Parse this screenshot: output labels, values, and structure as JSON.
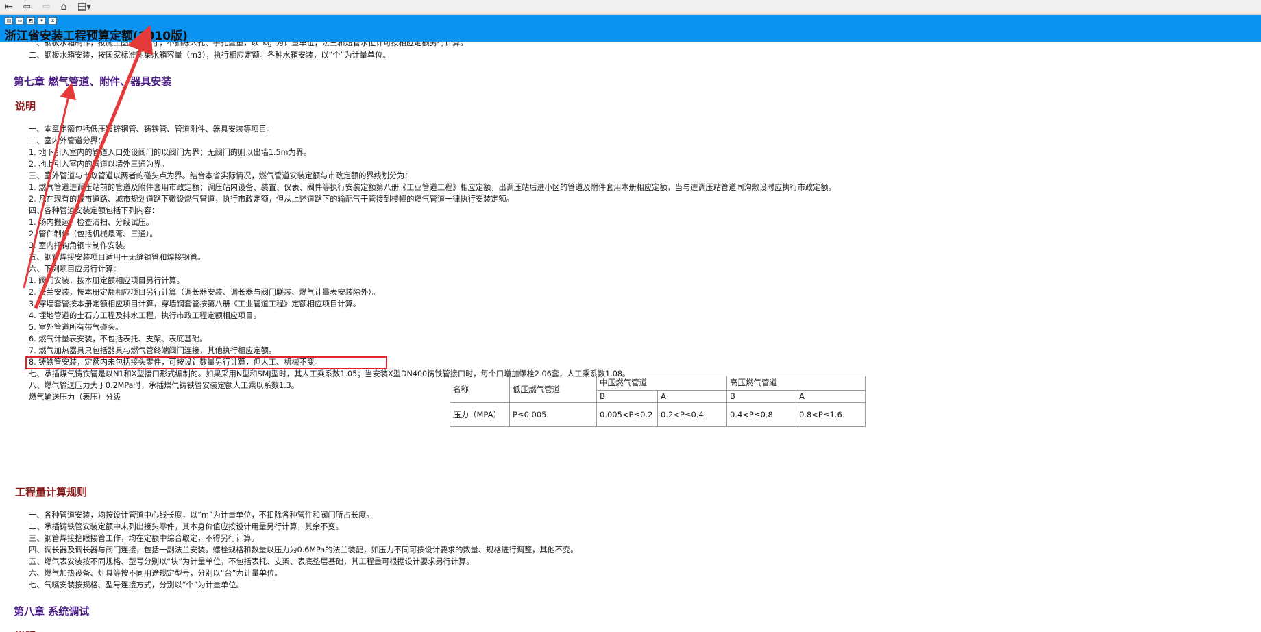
{
  "toolbar": {
    "buttons": [
      {
        "name": "toc-toggle-button",
        "glyph": "⇤"
      },
      {
        "name": "back-button",
        "glyph": "⇦"
      },
      {
        "name": "forward-button",
        "glyph": "⇨"
      },
      {
        "name": "home-button",
        "glyph": "⌂"
      },
      {
        "name": "options-button",
        "glyph": "▤▾"
      }
    ]
  },
  "strip": {
    "mini_buttons": [
      "▤",
      "▭",
      "◩",
      "▾",
      "⊻"
    ]
  },
  "document": {
    "title": "浙江省安装工程预算定额(2010版)",
    "top_lines": [
      "一、钢板水箱制作，按施工图所示尺寸，不扣除人孔、手孔重量，以“kg”为计量单位，法兰和短管水位计可按相应定额另行计算。",
      "二、钢板水箱安装，按国家标准图集水箱容量（m3），执行相应定额。各种水箱安装，以“个”为计量单位。"
    ],
    "chapter7_title": "第七章  燃气管道、附件、器具安装",
    "explain_title": "说明",
    "explain_lines": [
      "一、本章定额包括低压镀锌钢管、铸铁管、管道附件、器具安装等项目。",
      "二、室内外管道分界：",
      "1. 地下引入室内的管道入口处设阀门的以阀门为界；无阀门的则以出墙1.5m为界。",
      "2. 地上引入室内的管道以墙外三通为界。",
      "三、室外管道与市政管道以两者的碰头点为界。结合本省实际情况，燃气管道安装定额与市政定额的界线划分为：",
      "1. 燃气管道进调压站前的管道及附件套用市政定额；调压站内设备、装置、仪表、阀件等执行安装定额第八册《工业管道工程》相应定额，出调压站后进小区的管道及附件套用本册相应定额，当与进调压站管道同沟敷设时应执行市政定额。",
      "2. 凡在现有的城市道路、城市规划道路下敷设燃气管道，执行市政定额，但从上述道路下的输配气干管接到楼幢的燃气管道一律执行安装定额。",
      "四、各种管道安装定额包括下列内容：",
      "1. 场内搬运、检查清扫、分段试压。",
      "2. 管件制作（包括机械煨弯、三通）。",
      "3. 室内托钩角钢卡制作安装。",
      "五、钢管焊接安装项目适用于无缝钢管和焊接钢管。",
      "六、下列项目应另行计算：",
      "1. 阀门安装，按本册定额相应项目另行计算。",
      "2. 法兰安装，按本册定额相应项目另行计算（调长器安装、调长器与阀门联装、燃气计量表安装除外）。",
      "3. 穿墙套管按本册定额相应项目计算，穿墙钢套管按第八册《工业管道工程》定额相应项目计算。",
      "4. 埋地管道的土石方工程及排水工程，执行市政工程定额相应项目。",
      "5. 室外管道所有带气碰头。",
      "6. 燃气计量表安装，不包括表托、支架、表底基础。",
      "7. 燃气加热器具只包括器具与燃气管终端阀门连接，其他执行相应定额。",
      "8. 铸铁管安装，定额内未包括接头零件，可按设计数量另行计算，但人工、机械不变。",
      "七、承插煤气铸铁管是以N1和X型接口形式编制的。如果采用N型和SMJ型时，其人工乘系数1.05；当安装X型DN400铸铁管接口时，每个口增加螺栓2.06套，人工乘系数1.08。",
      "八、燃气输送压力大于0.2MPa时，承插煤气铸铁管安装定额人工乘以系数1.3。",
      "燃气输送压力（表压）分级"
    ],
    "pressure_table": {
      "col_name": "名称",
      "col_low": "低压燃气管道",
      "col_mid": "中压燃气管道",
      "col_high": "高压燃气管道",
      "sub_b1": "B",
      "sub_a1": "A",
      "sub_b2": "B",
      "sub_a2": "A",
      "row_label": "压力（MPA）",
      "v_low": "P≤0.005",
      "v_mid_b": "0.005<P≤0.2",
      "v_mid_a": "0.2<P≤0.4",
      "v_high_b": "0.4<P≤0.8",
      "v_high_a": "0.8<P≤1.6"
    },
    "calc_title": "工程量计算规则",
    "calc_lines": [
      "一、各种管道安装，均按设计管道中心线长度，以“m”为计量单位，不扣除各种管件和阀门所占长度。",
      "二、承插铸铁管安装定额中未列出接头零件，其本身价值应按设计用量另行计算，其余不变。",
      "三、钢管焊接挖眼接管工作，均在定额中综合取定，不得另行计算。",
      "四、调长器及调长器与阀门连接，包括一副法兰安装。螺栓规格和数量以压力为0.6MPa的法兰装配，如压力不同可按设计要求的数量、规格进行调整，其他不变。",
      "五、燃气表安装按不同规格、型号分别以“块”为计量单位，不包括表托、支架、表底垫层基础，其工程量可根据设计要求另行计算。",
      "六、燃气加热设备、灶具等按不同用途规定型号，分别以“台”为计量单位。",
      "七、气嘴安装按规格、型号连接方式，分别以“个”为计量单位。"
    ],
    "chapter8_title": "第八章  系统调试",
    "next_explain_title": "说明"
  }
}
